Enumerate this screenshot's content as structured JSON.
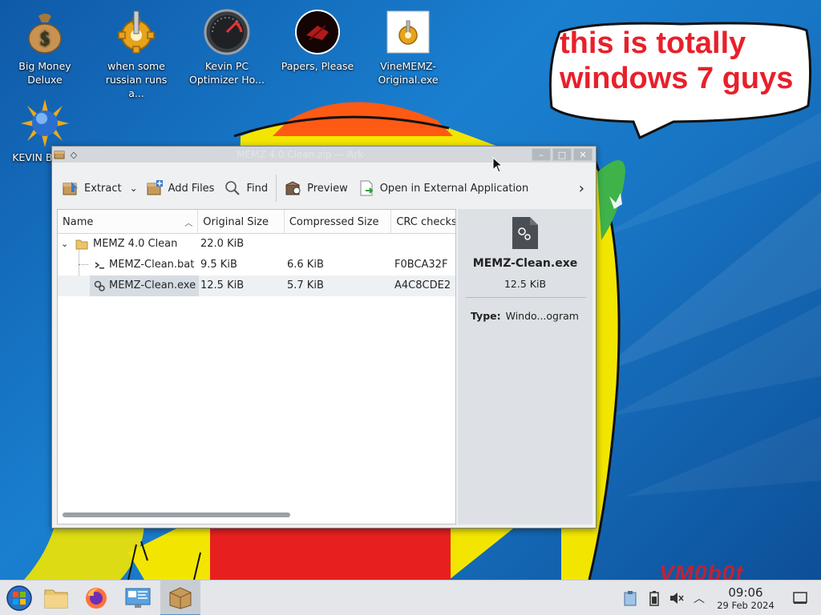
{
  "desktop": {
    "icons": [
      {
        "label": "Big Money\nDeluxe",
        "icon": "money-bag-icon"
      },
      {
        "label": "when some\nrussian runs a...",
        "icon": "gear-icon"
      },
      {
        "label": "Kevin PC\nOptimizer Ho...",
        "icon": "speedometer-icon"
      },
      {
        "label": "Papers, Please",
        "icon": "papers-please-icon"
      },
      {
        "label": "VineMEMZ-\nOriginal.exe",
        "icon": "exe-icon"
      },
      {
        "label": "KEVIN BLAST",
        "icon": "globe-sun-icon"
      }
    ],
    "bubble_text": "this is totally windows 7 guys",
    "watermark": "VM0b0t"
  },
  "window": {
    "title": "MEMZ 4.0 Clean.zip — Ark",
    "toolbar": {
      "extract": "Extract",
      "add_files": "Add Files",
      "find": "Find",
      "preview": "Preview",
      "open_external": "Open in External Application"
    },
    "columns": [
      "Name",
      "Original Size",
      "Compressed Size",
      "CRC checksu"
    ],
    "rows": [
      {
        "name": "MEMZ 4.0 Clean",
        "original": "22.0 KiB",
        "compressed": "",
        "crc": "",
        "type": "folder"
      },
      {
        "name": "MEMZ-Clean.bat",
        "original": "9.5 KiB",
        "compressed": "6.6 KiB",
        "crc": "F0BCA32F",
        "type": "bat"
      },
      {
        "name": "MEMZ-Clean.exe",
        "original": "12.5 KiB",
        "compressed": "5.7 KiB",
        "crc": "A4C8CDE2",
        "type": "exe"
      }
    ],
    "info": {
      "name": "MEMZ-Clean.exe",
      "size": "12.5 KiB",
      "type_label": "Type:",
      "type_value": "Windo...ogram"
    }
  },
  "taskbar": {
    "apps": [
      "start-orb-icon",
      "file-manager-icon",
      "firefox-icon",
      "system-settings-icon",
      "ark-archiver-icon"
    ],
    "tray": [
      "clipboard-icon",
      "battery-icon",
      "volume-muted-icon",
      "tray-expand-icon"
    ],
    "clock": {
      "time": "09:06",
      "date": "29 Feb 2024"
    }
  },
  "colors": {
    "bubble_text": "#e8202a",
    "desktop_blue": "#1a7fd0",
    "window_bg": "#eff0f1"
  }
}
